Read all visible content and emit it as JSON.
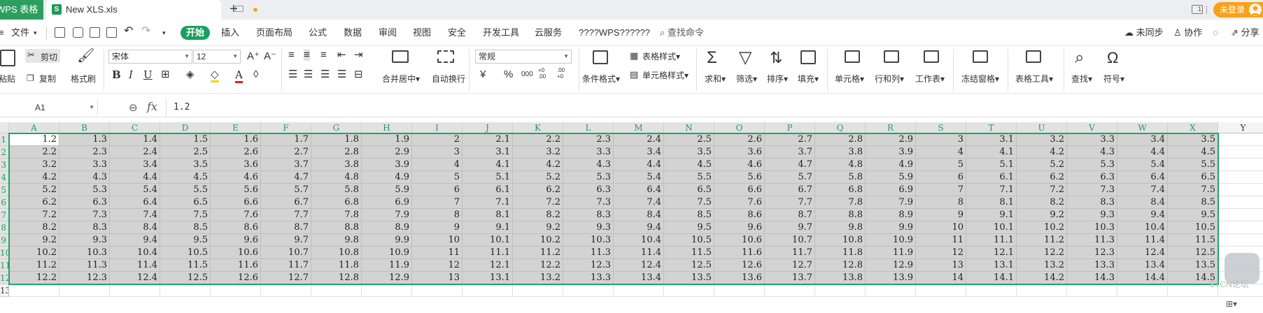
{
  "titlebar": {
    "app_tab": "WPS 表格",
    "file_tab": "New XLS.xls",
    "file_icon": "S",
    "login": "未登录"
  },
  "menubar": {
    "file": "文件",
    "items": [
      "开始",
      "插入",
      "页面布局",
      "公式",
      "数据",
      "审阅",
      "视图",
      "安全",
      "开发工具",
      "云服务",
      "????WPS??????"
    ],
    "search": "查找命令",
    "sync": "未同步",
    "collab": "协作",
    "share": "分享"
  },
  "ribbon": {
    "paste": "粘贴",
    "cut": "剪切",
    "copy": "复制",
    "format_painter": "格式刷",
    "font_name": "宋体",
    "font_size": "12",
    "number_format": "常规",
    "merge_center": "合并居中",
    "wrap_text": "自动换行",
    "conditional_format": "条件格式",
    "table_style": "表格样式",
    "cell_style": "单元格样式",
    "sum": "求和",
    "filter": "筛选",
    "sort": "排序",
    "fill": "填充",
    "cell": "单元格",
    "row_col": "行和列",
    "worksheet": "工作表",
    "freeze": "冻结窗格",
    "table_tools": "表格工具",
    "find": "查找",
    "symbol": "符号",
    "currency": "¥",
    "percent": "%",
    "thousands": "000",
    "dec_inc": "+0 .00",
    "dec_dec": ".00 +0"
  },
  "formula_bar": {
    "cell_ref": "A1",
    "fx": "fx",
    "value": "1.2"
  },
  "grid": {
    "columns": [
      "A",
      "B",
      "C",
      "D",
      "E",
      "F",
      "G",
      "H",
      "I",
      "J",
      "K",
      "L",
      "M",
      "N",
      "O",
      "P",
      "Q",
      "R",
      "S",
      "T",
      "U",
      "V",
      "W",
      "X",
      "Y"
    ],
    "row_labels": [
      "1",
      "2",
      "3",
      "4",
      "5",
      "6",
      "7",
      "8",
      "9",
      "10",
      "11",
      "12",
      "13"
    ],
    "rows": [
      [
        "1.2",
        "1.3",
        "1.4",
        "1.5",
        "1.6",
        "1.7",
        "1.8",
        "1.9",
        "2",
        "2.1",
        "2.2",
        "2.3",
        "2.4",
        "2.5",
        "2.6",
        "2.7",
        "2.8",
        "2.9",
        "3",
        "3.1",
        "3.2",
        "3.3",
        "3.4",
        "3.5"
      ],
      [
        "2.2",
        "2.3",
        "2.4",
        "2.5",
        "2.6",
        "2.7",
        "2.8",
        "2.9",
        "3",
        "3.1",
        "3.2",
        "3.3",
        "3.4",
        "3.5",
        "3.6",
        "3.7",
        "3.8",
        "3.9",
        "4",
        "4.1",
        "4.2",
        "4.3",
        "4.4",
        "4.5"
      ],
      [
        "3.2",
        "3.3",
        "3.4",
        "3.5",
        "3.6",
        "3.7",
        "3.8",
        "3.9",
        "4",
        "4.1",
        "4.2",
        "4.3",
        "4.4",
        "4.5",
        "4.6",
        "4.7",
        "4.8",
        "4.9",
        "5",
        "5.1",
        "5.2",
        "5.3",
        "5.4",
        "5.5"
      ],
      [
        "4.2",
        "4.3",
        "4.4",
        "4.5",
        "4.6",
        "4.7",
        "4.8",
        "4.9",
        "5",
        "5.1",
        "5.2",
        "5.3",
        "5.4",
        "5.5",
        "5.6",
        "5.7",
        "5.8",
        "5.9",
        "6",
        "6.1",
        "6.2",
        "6.3",
        "6.4",
        "6.5"
      ],
      [
        "5.2",
        "5.3",
        "5.4",
        "5.5",
        "5.6",
        "5.7",
        "5.8",
        "5.9",
        "6",
        "6.1",
        "6.2",
        "6.3",
        "6.4",
        "6.5",
        "6.6",
        "6.7",
        "6.8",
        "6.9",
        "7",
        "7.1",
        "7.2",
        "7.3",
        "7.4",
        "7.5"
      ],
      [
        "6.2",
        "6.3",
        "6.4",
        "6.5",
        "6.6",
        "6.7",
        "6.8",
        "6.9",
        "7",
        "7.1",
        "7.2",
        "7.3",
        "7.4",
        "7.5",
        "7.6",
        "7.7",
        "7.8",
        "7.9",
        "8",
        "8.1",
        "8.2",
        "8.3",
        "8.4",
        "8.5"
      ],
      [
        "7.2",
        "7.3",
        "7.4",
        "7.5",
        "7.6",
        "7.7",
        "7.8",
        "7.9",
        "8",
        "8.1",
        "8.2",
        "8.3",
        "8.4",
        "8.5",
        "8.6",
        "8.7",
        "8.8",
        "8.9",
        "9",
        "9.1",
        "9.2",
        "9.3",
        "9.4",
        "9.5"
      ],
      [
        "8.2",
        "8.3",
        "8.4",
        "8.5",
        "8.6",
        "8.7",
        "8.8",
        "8.9",
        "9",
        "9.1",
        "9.2",
        "9.3",
        "9.4",
        "9.5",
        "9.6",
        "9.7",
        "9.8",
        "9.9",
        "10",
        "10.1",
        "10.2",
        "10.3",
        "10.4",
        "10.5"
      ],
      [
        "9.2",
        "9.3",
        "9.4",
        "9.5",
        "9.6",
        "9.7",
        "9.8",
        "9.9",
        "10",
        "10.1",
        "10.2",
        "10.3",
        "10.4",
        "10.5",
        "10.6",
        "10.7",
        "10.8",
        "10.9",
        "11",
        "11.1",
        "11.2",
        "11.3",
        "11.4",
        "11.5"
      ],
      [
        "10.2",
        "10.3",
        "10.4",
        "10.5",
        "10.6",
        "10.7",
        "10.8",
        "10.9",
        "11",
        "11.1",
        "11.2",
        "11.3",
        "11.4",
        "11.5",
        "11.6",
        "11.7",
        "11.8",
        "11.9",
        "12",
        "12.1",
        "12.2",
        "12.3",
        "12.4",
        "12.5"
      ],
      [
        "11.2",
        "11.3",
        "11.4",
        "11.5",
        "11.6",
        "11.7",
        "11.8",
        "11.9",
        "12",
        "12.1",
        "12.2",
        "12.3",
        "12.4",
        "12.5",
        "12.6",
        "12.7",
        "12.8",
        "12.9",
        "13",
        "13.1",
        "13.2",
        "13.3",
        "13.4",
        "13.5"
      ],
      [
        "12.2",
        "12.3",
        "12.4",
        "12.5",
        "12.6",
        "12.7",
        "12.8",
        "12.9",
        "13",
        "13.1",
        "13.2",
        "13.3",
        "13.4",
        "13.5",
        "13.6",
        "13.7",
        "13.8",
        "13.9",
        "14",
        "14.1",
        "14.2",
        "14.3",
        "14.4",
        "14.5"
      ]
    ]
  },
  "watermark": "STCN论坛",
  "colors": {
    "accent": "#1aa05e",
    "selection": "#1fa56b",
    "login": "#f7a21b",
    "cell_fill": "#d3d3d3"
  }
}
